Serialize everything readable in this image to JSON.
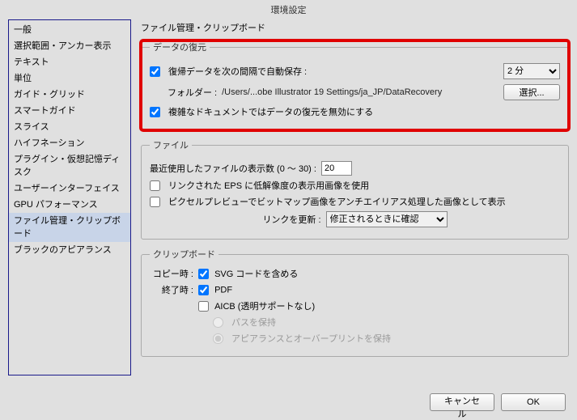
{
  "window_title": "環境設定",
  "sidebar": {
    "items": [
      {
        "label": "一般"
      },
      {
        "label": "選択範囲・アンカー表示"
      },
      {
        "label": "テキスト"
      },
      {
        "label": "単位"
      },
      {
        "label": "ガイド・グリッド"
      },
      {
        "label": "スマートガイド"
      },
      {
        "label": "スライス"
      },
      {
        "label": "ハイフネーション"
      },
      {
        "label": "プラグイン・仮想記憶ディスク"
      },
      {
        "label": "ユーザーインターフェイス"
      },
      {
        "label": "GPU パフォーマンス"
      },
      {
        "label": "ファイル管理・クリップボード"
      },
      {
        "label": "ブラックのアピアランス"
      }
    ],
    "selected_index": 11
  },
  "main_title": "ファイル管理・クリップボード",
  "recovery": {
    "legend": "データの復元",
    "autosave_label": "復帰データを次の間隔で自動保存 :",
    "autosave_checked": true,
    "interval_value": "2 分",
    "folder_label": "フォルダー :",
    "folder_path": "/Users/...obe Illustrator 19 Settings/ja_JP/DataRecovery",
    "choose_label": "選択...",
    "disable_complex_label": "複雑なドキュメントではデータの復元を無効にする",
    "disable_complex_checked": true
  },
  "file": {
    "legend": "ファイル",
    "recent_label_pre": "最近使用したファイルの表示数 (0 ～ 30)  :",
    "recent_value": "20",
    "eps_label": "リンクされた EPS に低解像度の表示用画像を使用",
    "eps_checked": false,
    "pixelpreview_label": "ピクセルプレビューでビットマップ画像をアンチエイリアス処理した画像として表示",
    "pixelpreview_checked": false,
    "link_update_label": "リンクを更新 :",
    "link_update_value": "修正されるときに確認"
  },
  "clipboard": {
    "legend": "クリップボード",
    "copy_label": "コピー時 :",
    "quit_label": "終了時 :",
    "svg_label": "SVG コードを含める",
    "svg_checked": true,
    "pdf_label": "PDF",
    "pdf_checked": true,
    "aicb_label": "AICB (透明サポートなし)",
    "aicb_checked": false,
    "radio_path_label": "パスを保持",
    "radio_appearance_label": "アピアランスとオーバープリントを保持"
  },
  "footer": {
    "cancel": "キャンセル",
    "ok": "OK"
  }
}
